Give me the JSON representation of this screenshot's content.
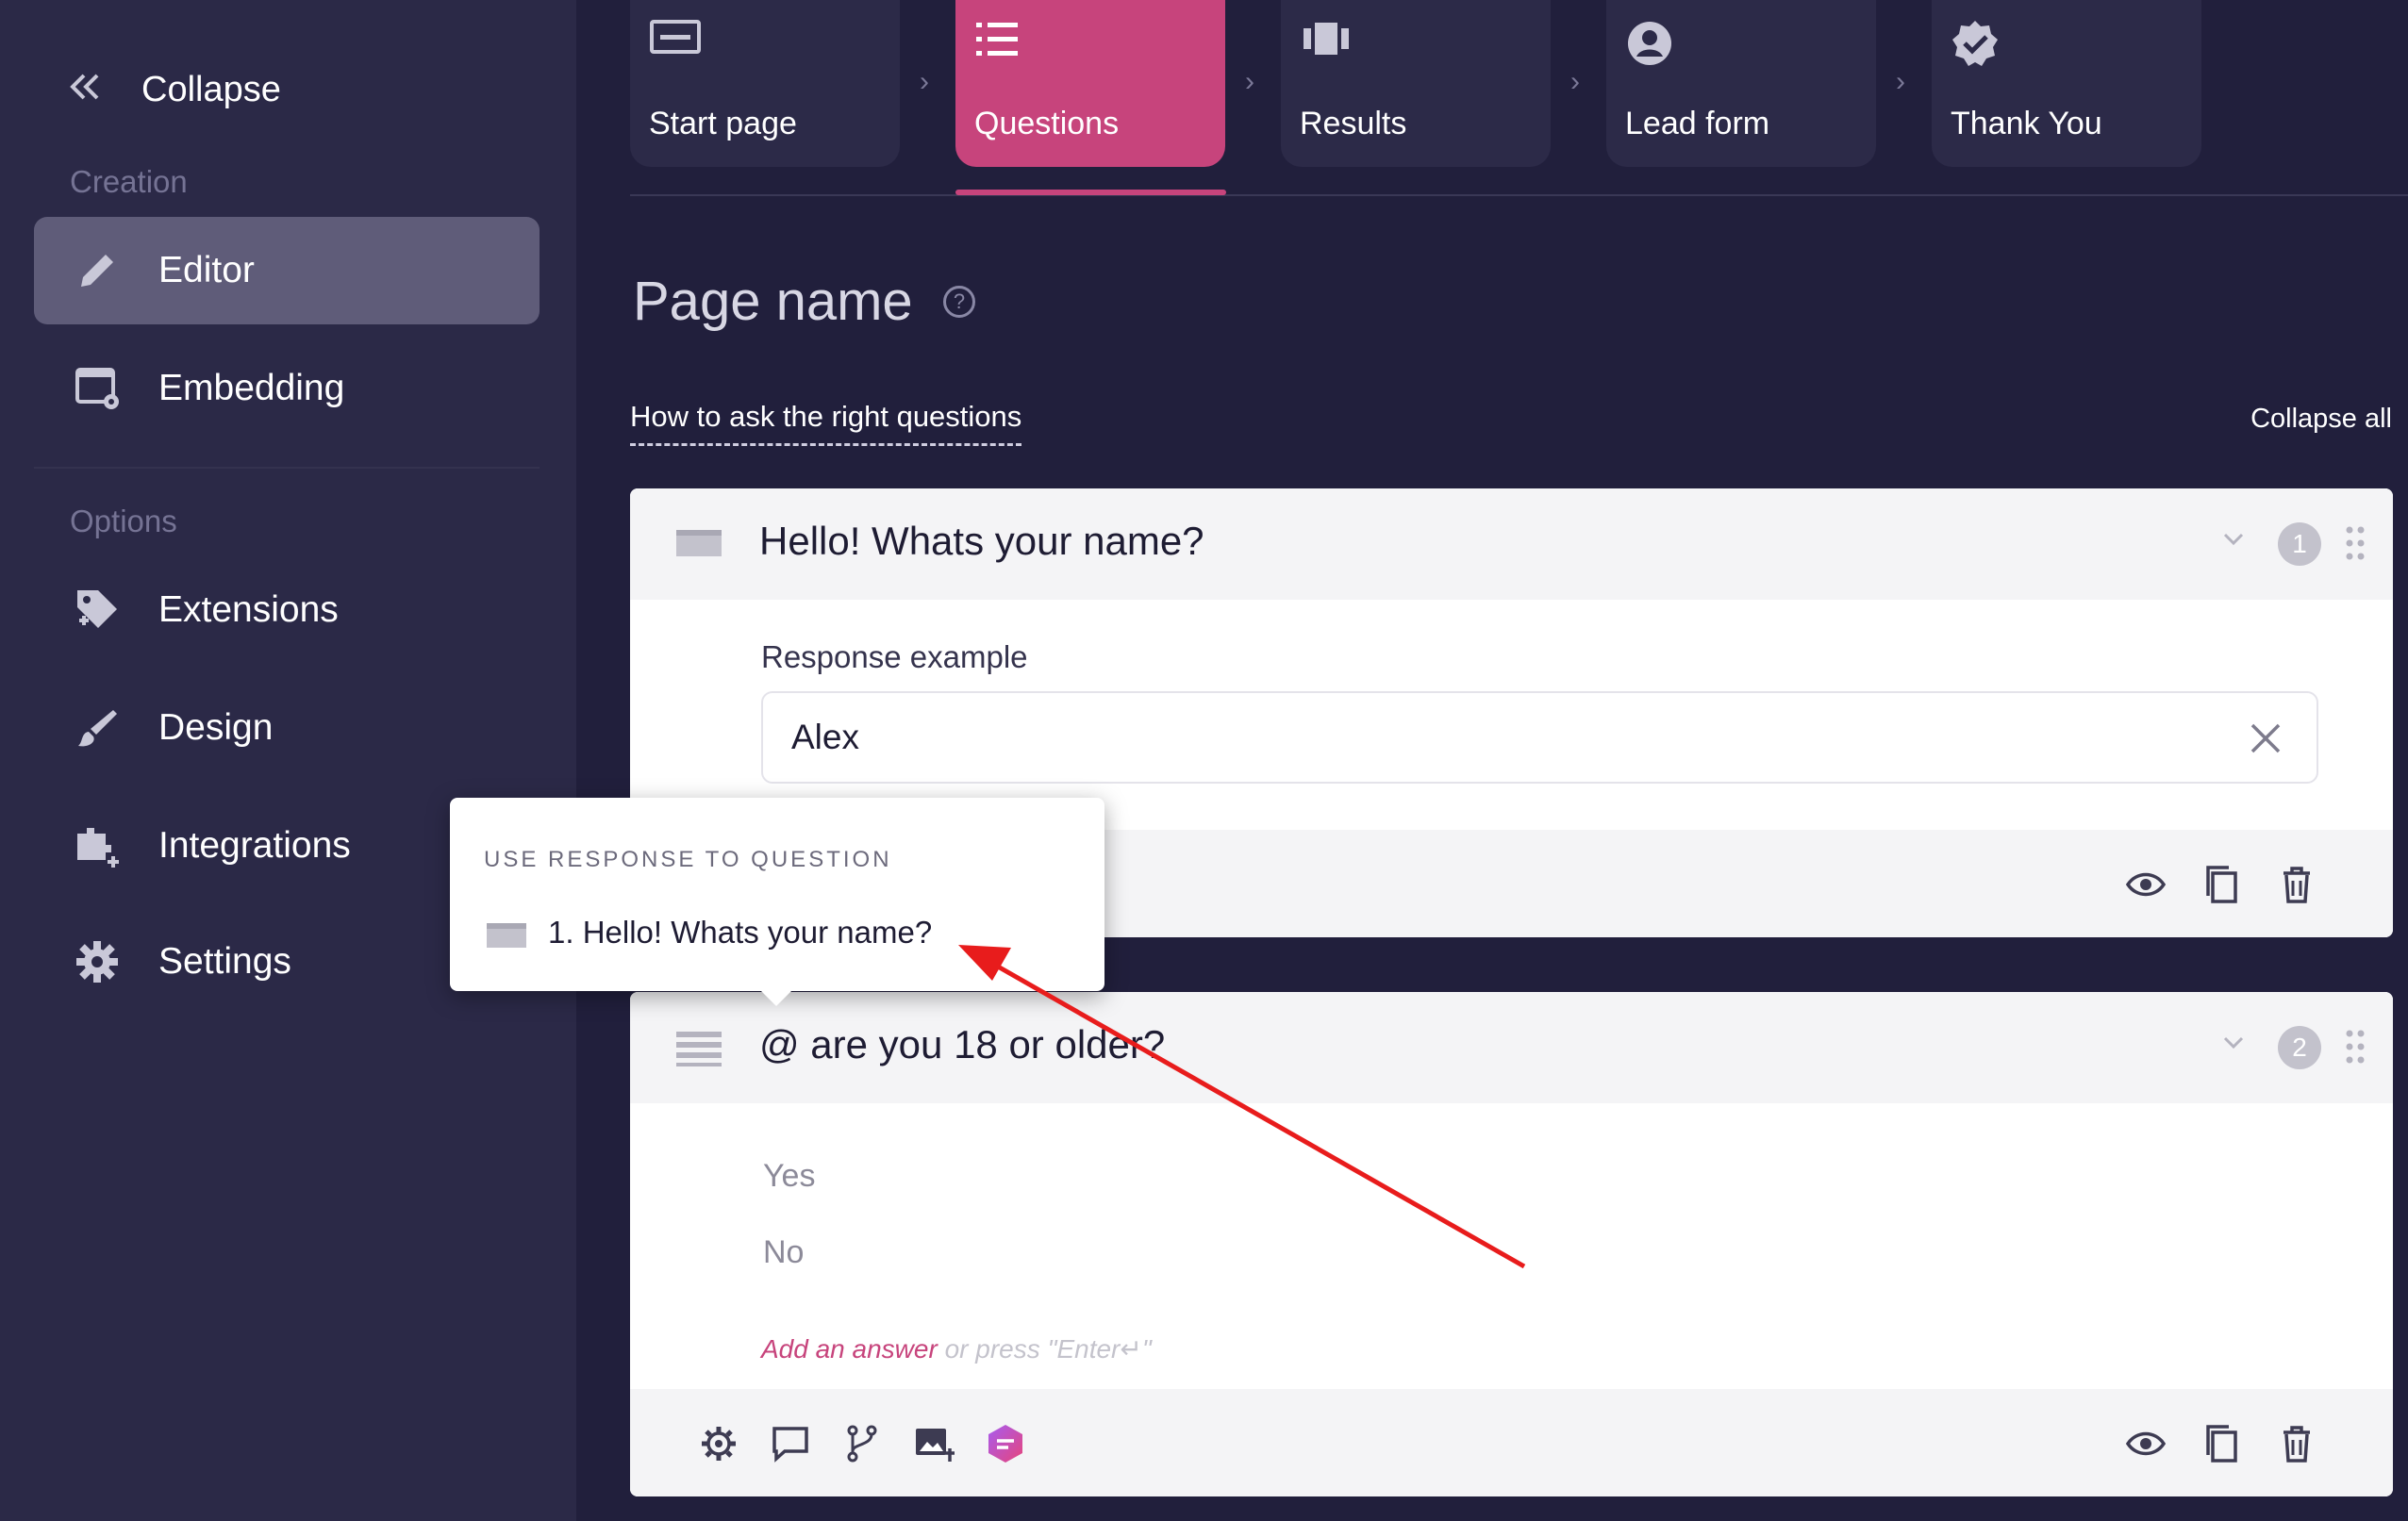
{
  "sidebar": {
    "collapse_label": "Collapse",
    "section_creation": "Creation",
    "section_options": "Options",
    "items": [
      {
        "label": "Editor",
        "icon": "pencil-icon",
        "active": true
      },
      {
        "label": "Embedding",
        "icon": "embed-settings-icon"
      },
      {
        "label": "Extensions",
        "icon": "puzzle-tag-icon"
      },
      {
        "label": "Design",
        "icon": "brush-icon"
      },
      {
        "label": "Integrations",
        "icon": "integration-plus-icon"
      },
      {
        "label": "Settings",
        "icon": "gear-icon"
      }
    ]
  },
  "tabs": [
    {
      "label": "Start page",
      "icon": "start-page-icon"
    },
    {
      "label": "Questions",
      "icon": "list-icon",
      "active": true
    },
    {
      "label": "Results",
      "icon": "results-icon"
    },
    {
      "label": "Lead form",
      "icon": "user-circle-icon"
    },
    {
      "label": "Thank You",
      "icon": "verified-badge-icon"
    }
  ],
  "main": {
    "page_title": "Page name",
    "help_glyph": "?",
    "how_to_link": "How to ask the right questions",
    "collapse_all": "Collapse all"
  },
  "questions": [
    {
      "number": "1",
      "title": "Hello! Whats your name?",
      "type_icon": "text-field-icon",
      "response_label": "Response example",
      "response_value": "Alex"
    },
    {
      "number": "2",
      "title": "@ are you 18 or older?",
      "type_icon": "list-lines-icon",
      "answers": [
        "Yes",
        "No"
      ],
      "add_answer_link": "Add an answer",
      "add_answer_hint": " or press \"Enter↵\""
    }
  ],
  "popup": {
    "header": "USE RESPONSE TO QUESTION",
    "item_label": "1. Hello! Whats your name?"
  },
  "colors": {
    "background": "#211f3c",
    "sidebar": "#2b2947",
    "accent": "#c7447c",
    "annotation_arrow": "#e81c1c"
  }
}
